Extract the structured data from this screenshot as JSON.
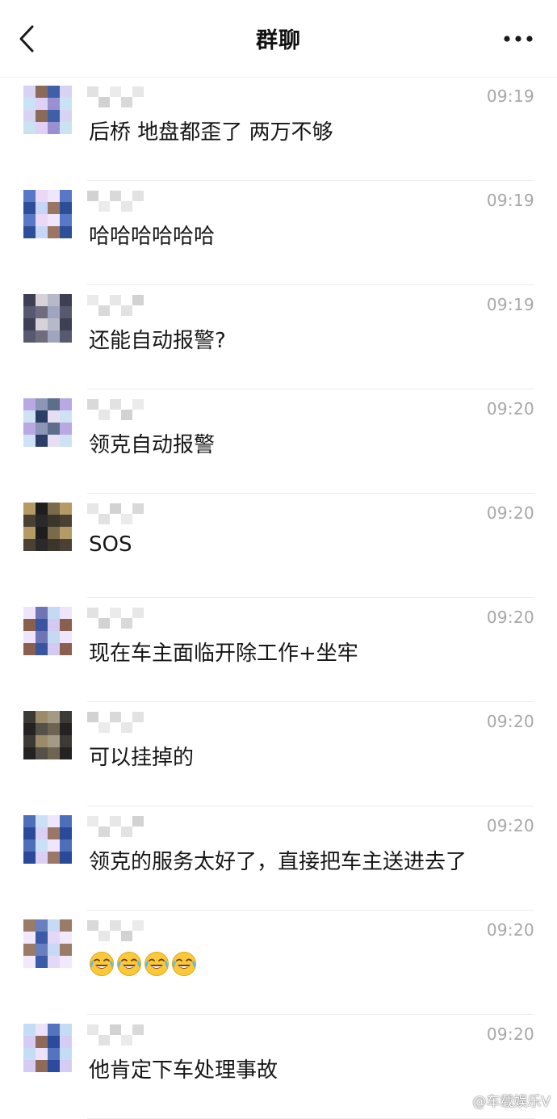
{
  "header": {
    "title": "群聊",
    "back_icon": "chevron-left-icon",
    "more_icon": "more-dots-icon"
  },
  "messages": [
    {
      "sender": "",
      "time": "09:19",
      "text": "后桥 地盘都歪了 两万不够",
      "avatar_palette": [
        "#d8d3f3",
        "#9a8fd0",
        "#8a6b5a",
        "#c9e3f5",
        "#3f5fa8",
        "#e0d0f5"
      ]
    },
    {
      "sender": "",
      "time": "09:19",
      "text": "哈哈哈哈哈哈",
      "avatar_palette": [
        "#c6d6f6",
        "#5877c6",
        "#9a7562",
        "#e9d9f6",
        "#2d4e98",
        "#f0e6fb"
      ]
    },
    {
      "sender": "",
      "time": "09:19",
      "text": "还能自动报警?",
      "avatar_palette": [
        "#b7b9c8",
        "#6f6d7d",
        "#3e3f52",
        "#9fa5be",
        "#d7d2d8",
        "#575970"
      ]
    },
    {
      "sender": "",
      "time": "09:20",
      "text": "领克自动报警",
      "avatar_palette": [
        "#cfe2f4",
        "#5d6e8a",
        "#2c3d66",
        "#b9a8e2",
        "#e6dff4",
        "#8d96b6"
      ]
    },
    {
      "sender": "",
      "time": "09:20",
      "text": "SOS",
      "avatar_palette": [
        "#1e1e1e",
        "#4a4033",
        "#7a6a4c",
        "#2a2a2a",
        "#b49a65",
        "#3b352c"
      ]
    },
    {
      "sender": "",
      "time": "09:20",
      "text": "现在车主面临开除工作+坐牢",
      "avatar_palette": [
        "#d4c9f1",
        "#6e76b5",
        "#8a5f4e",
        "#c5d9f2",
        "#3a55a0",
        "#efe5fb"
      ]
    },
    {
      "sender": "",
      "time": "09:20",
      "text": "可以挂掉的",
      "avatar_palette": [
        "#3b3a35",
        "#6d6552",
        "#9b8b68",
        "#242321",
        "#a59a86",
        "#55504a"
      ]
    },
    {
      "sender": "",
      "time": "09:20",
      "text": "领克的服务太好了，直接把车主送进去了",
      "avatar_palette": [
        "#d9d0f4",
        "#4f6eb9",
        "#9b7767",
        "#c9e0f7",
        "#284a99",
        "#eee6fb"
      ]
    },
    {
      "sender": "",
      "time": "09:20",
      "text": "",
      "emoji": [
        "😂",
        "😂",
        "😂",
        "😂"
      ],
      "emoji_name": "tears-of-joy-emoji",
      "avatar_palette": [
        "#c7daf5",
        "#3a5ba6",
        "#9a7b66",
        "#e4d8f6",
        "#6a7fc0",
        "#f1e9fb"
      ]
    },
    {
      "sender": "",
      "time": "09:20",
      "text": "他肯定下车处理事故",
      "avatar_palette": [
        "#d6ccf3",
        "#5673bf",
        "#8f6a58",
        "#c5dcf5",
        "#2b4c9c",
        "#ece3fb"
      ]
    }
  ],
  "watermark": {
    "icon": "weibo-icon",
    "text": "@车载娱乐V"
  },
  "colors": {
    "background": "#ffffff",
    "divider": "#ececec",
    "time": "#a7a7a7",
    "text": "#161616"
  }
}
